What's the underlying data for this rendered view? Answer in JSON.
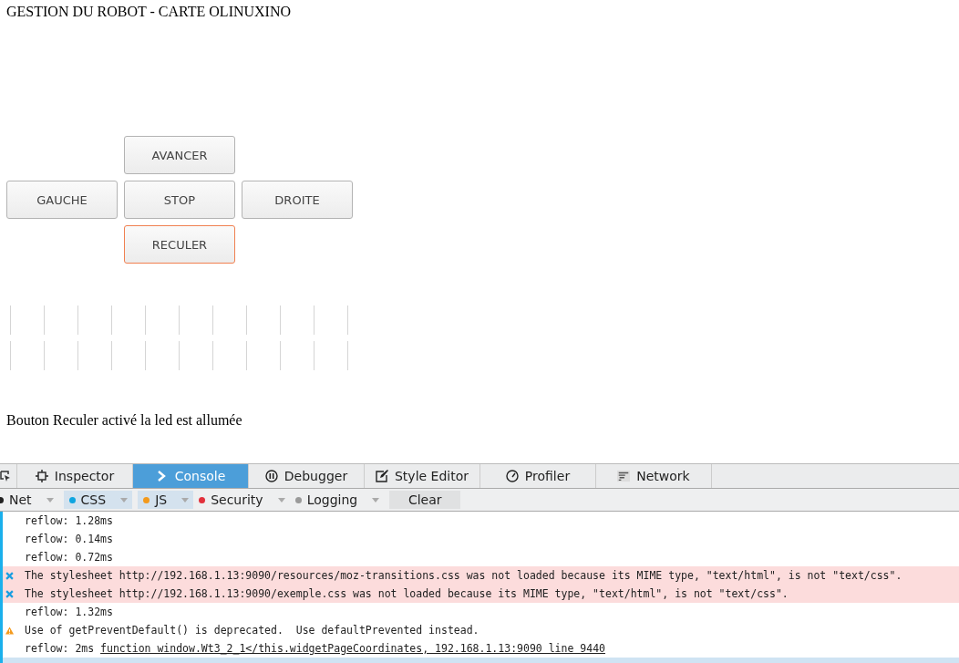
{
  "page_title": "GESTION DU ROBOT - CARTE OLINUXINO",
  "controls": [
    {
      "label": "AVANCER",
      "focused": false
    },
    {
      "label": "GAUCHE",
      "focused": false
    },
    {
      "label": "STOP",
      "focused": false
    },
    {
      "label": "DROITE",
      "focused": false
    },
    {
      "label": "RECULER",
      "focused": true
    }
  ],
  "status_message": "Bouton Reculer activé la led est allumée",
  "devtools": {
    "tabs": [
      {
        "label": "Inspector",
        "selected": false
      },
      {
        "label": "Console",
        "selected": true
      },
      {
        "label": "Debugger",
        "selected": false
      },
      {
        "label": "Style Editor",
        "selected": false
      },
      {
        "label": "Profiler",
        "selected": false
      },
      {
        "label": "Network",
        "selected": false
      }
    ],
    "filters": [
      {
        "label": "Net",
        "color": "#222222",
        "selected": false
      },
      {
        "label": "CSS",
        "color": "#0ea5e0",
        "selected": true
      },
      {
        "label": "JS",
        "color": "#f39a1c",
        "selected": true
      },
      {
        "label": "Security",
        "color": "#e2303b",
        "selected": false
      },
      {
        "label": "Logging",
        "color": "#9a9a9a",
        "selected": false
      }
    ],
    "clear_button": "Clear",
    "messages": [
      {
        "kind": "log",
        "text": "reflow: 1.28ms"
      },
      {
        "kind": "log",
        "text": "reflow: 0.14ms"
      },
      {
        "kind": "log",
        "text": "reflow: 0.72ms"
      },
      {
        "kind": "error",
        "text": "The stylesheet http://192.168.1.13:9090/resources/moz-transitions.css was not loaded because its MIME type, \"text/html\", is not \"text/css\"."
      },
      {
        "kind": "error",
        "text": "The stylesheet http://192.168.1.13:9090/exemple.css was not loaded because its MIME type, \"text/html\", is not \"text/css\"."
      },
      {
        "kind": "log",
        "text": "reflow: 1.32ms"
      },
      {
        "kind": "warning",
        "text": "Use of getPreventDefault() is deprecated.  Use defaultPrevented instead."
      },
      {
        "kind": "log",
        "text": "reflow: 2ms",
        "link": "function window.Wt3_2_1</this.widgetPageCoordinates, 192.168.1.13:9090 line 9440"
      },
      {
        "kind": "selected"
      }
    ]
  }
}
